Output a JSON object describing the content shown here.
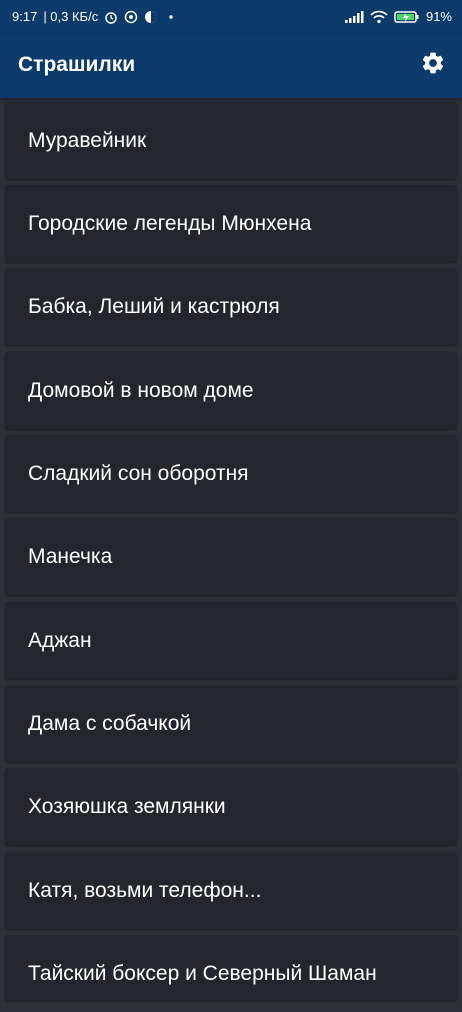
{
  "status_bar": {
    "time": "9:17",
    "speed": "| 0,3 КБ/с",
    "battery": "91%",
    "icons": [
      "alarm-icon",
      "whatsapp-icon",
      "app-icon",
      "dot-icon",
      "signal-icon",
      "wifi-icon",
      "battery-charging-icon"
    ]
  },
  "app_bar": {
    "title": "Страшилки",
    "settings_icon": "gear-icon"
  },
  "stories": [
    {
      "title": "Муравейник"
    },
    {
      "title": "Городские легенды Мюнхена"
    },
    {
      "title": "Бабка, Леший и кастрюля"
    },
    {
      "title": "Домовой в новом доме"
    },
    {
      "title": "Сладкий сон оборотня"
    },
    {
      "title": "Манечка"
    },
    {
      "title": "Аджан"
    },
    {
      "title": "Дама с собачкой"
    },
    {
      "title": "Хозяюшка землянки"
    },
    {
      "title": "Катя, возьми телефон..."
    },
    {
      "title": "Тайский боксер и Северный Шаман"
    }
  ],
  "colors": {
    "app_bar": "#0b3a6b",
    "background": "#2e3137",
    "card": "#23262c",
    "text": "#ffffff"
  }
}
